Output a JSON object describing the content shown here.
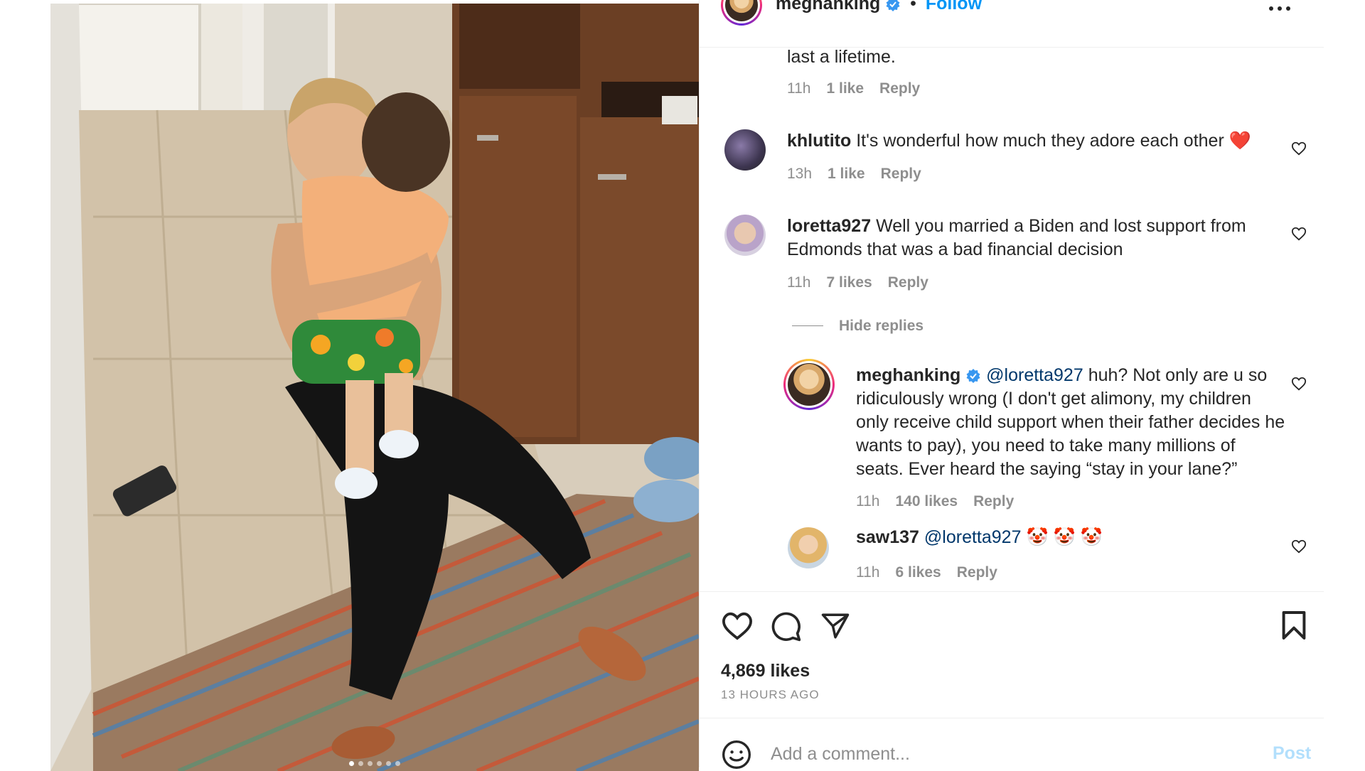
{
  "post": {
    "author": "meghanking",
    "follow_label": "Follow",
    "more_icon": "more-horizontal-icon",
    "likes": "4,869 likes",
    "time_ago": "13 HOURS AGO",
    "carousel_pages": 6,
    "carousel_active": 1
  },
  "comments": [
    {
      "text_tail": "last a lifetime.",
      "time": "11h",
      "likes": "1 like",
      "reply": "Reply"
    },
    {
      "username": "khlutito",
      "text": "It's wonderful how much they adore each other",
      "emoji": "❤️",
      "time": "13h",
      "likes": "1 like",
      "reply": "Reply"
    },
    {
      "username": "loretta927",
      "text_line1": "Well you married a Biden and lost support from",
      "text_line2": "Edmonds that was a bad financial decision",
      "time": "11h",
      "likes": "7 likes",
      "reply": "Reply",
      "hide_replies": "Hide replies"
    }
  ],
  "replies": [
    {
      "username": "meghanking",
      "mention": "@loretta927",
      "line1": "huh? Not only are u so",
      "line2": "ridiculously wrong (I don't get alimony, my children",
      "line3": "only receive child support when their father decides he",
      "line4": "wants to pay), you need to take many millions of",
      "line5": "seats. Ever heard the saying “stay in your lane?”",
      "time": "11h",
      "likes": "140 likes",
      "reply": "Reply"
    },
    {
      "username": "saw137",
      "mention": "@loretta927",
      "emoji": "🤡 🤡 🤡",
      "time": "11h",
      "likes": "6 likes",
      "reply": "Reply"
    }
  ],
  "composer": {
    "placeholder": "Add a comment...",
    "post_label": "Post"
  },
  "colors": {
    "accent_blue": "#0095f6",
    "verified_blue": "#3897f0",
    "heart_red": "#ed4956"
  }
}
